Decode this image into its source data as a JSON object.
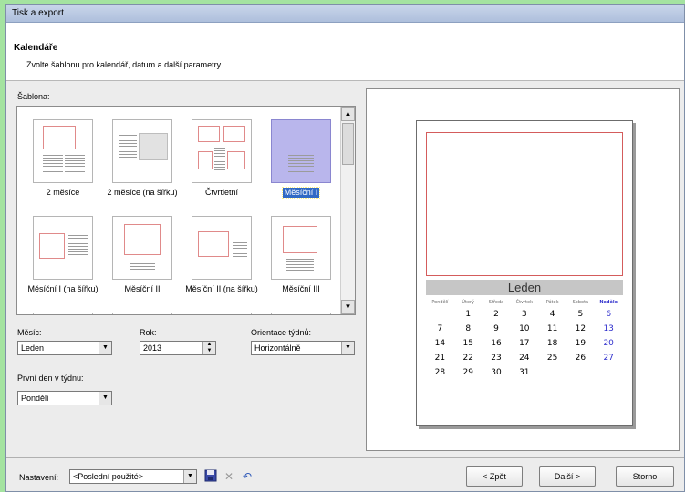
{
  "window": {
    "title": "Tisk a export"
  },
  "header": {
    "title": "Kalendáře",
    "subtitle": "Zvolte šablonu pro kalendář, datum a další parametry."
  },
  "templates": {
    "label": "Šablona:",
    "items": [
      {
        "label": "2 měsíce"
      },
      {
        "label": "2 měsíce (na šířku)"
      },
      {
        "label": "Čtvrtletní"
      },
      {
        "label": "Měsíční I"
      },
      {
        "label": "Měsíční I (na šířku)"
      },
      {
        "label": "Měsíční II"
      },
      {
        "label": "Měsíční II (na šířku)"
      },
      {
        "label": "Měsíční III"
      }
    ],
    "selected": "Měsíční I"
  },
  "form": {
    "month_label": "Měsíc:",
    "month_value": "Leden",
    "year_label": "Rok:",
    "year_value": "2013",
    "orientation_label": "Orientace týdnů:",
    "orientation_value": "Horizontálně",
    "firstday_label": "První den v týdnu:",
    "firstday_value": "Pondělí"
  },
  "preview": {
    "month": "Leden",
    "weekdays": [
      "Pondělí",
      "Úterý",
      "Středa",
      "Čtvrtek",
      "Pátek",
      "Sobota",
      "Neděle"
    ],
    "weeks": [
      [
        "",
        "1",
        "2",
        "3",
        "4",
        "5",
        "6"
      ],
      [
        "7",
        "8",
        "9",
        "10",
        "11",
        "12",
        "13"
      ],
      [
        "14",
        "15",
        "16",
        "17",
        "18",
        "19",
        "20"
      ],
      [
        "21",
        "22",
        "23",
        "24",
        "25",
        "26",
        "27"
      ],
      [
        "28",
        "29",
        "30",
        "31",
        "",
        "",
        ""
      ]
    ]
  },
  "footer": {
    "settings_label": "Nastavení:",
    "settings_value": "<Poslední použité>",
    "back_label": "< Zpět",
    "next_label": "Další >",
    "cancel_label": "Storno"
  },
  "icons": {
    "save": "save-icon",
    "delete": "delete-icon",
    "undo": "undo-icon"
  }
}
